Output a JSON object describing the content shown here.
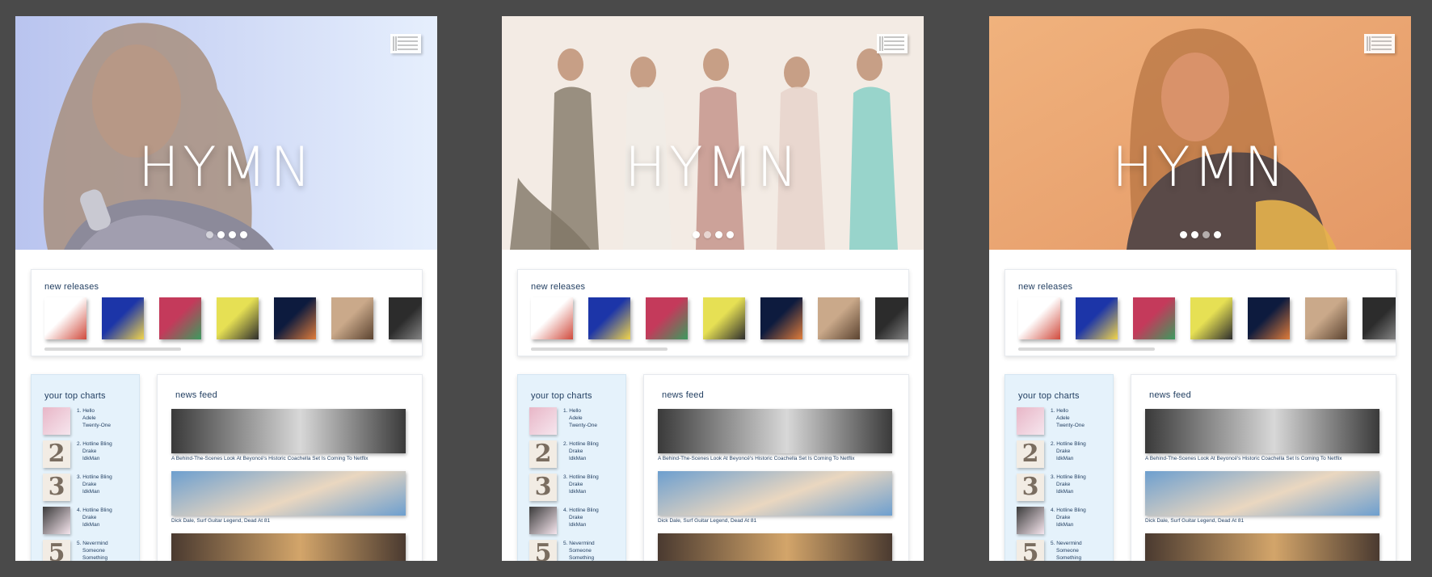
{
  "screens": [
    {
      "id": "screen-1",
      "variant": "beyonce",
      "active_dot": 0
    },
    {
      "id": "screen-2",
      "variant": "band",
      "active_dot": 1
    },
    {
      "id": "screen-3",
      "variant": "taylor",
      "active_dot": 2
    }
  ],
  "app": {
    "logo": "HYMN",
    "menu_icon": "menu-icon",
    "carousel_dots": 4
  },
  "new_releases": {
    "title": "new releases",
    "covers": [
      "album-cover-1",
      "album-cover-2",
      "album-cover-3",
      "album-cover-4",
      "album-cover-5",
      "album-cover-6",
      "album-cover-7"
    ],
    "scroll_progress": 0.35
  },
  "top_charts": {
    "title": "your top charts",
    "items": [
      {
        "rank_title": "1. Hello",
        "artist": "Adele",
        "album": "Twenty-One"
      },
      {
        "rank_title": "2. Hotline Bling",
        "artist": "Drake",
        "album": "IdkMan"
      },
      {
        "rank_title": "3. Hotline Bling",
        "artist": "Drake",
        "album": "IdkMan"
      },
      {
        "rank_title": "4. Hotline Bling",
        "artist": "Drake",
        "album": "IdkMan"
      },
      {
        "rank_title": "5. Nevermind",
        "artist": "Someone",
        "album": "Something"
      }
    ]
  },
  "news_feed": {
    "title": "news feed",
    "articles": [
      {
        "caption": "A Behind-The-Scenes Look At Beyoncé's Historic Coachella Set Is Coming To Netflix"
      },
      {
        "caption": "Dick Dale, Surf Guitar Legend, Dead At 81"
      },
      {
        "caption": ""
      }
    ]
  },
  "colors": {
    "background": "#4a4a4a",
    "accent_text": "#1f3c5f",
    "charts_panel": "#e5f2fb",
    "hero_1": "#c9d6f6",
    "hero_2": "#f3ebe4",
    "hero_3": "#e9a06e"
  }
}
